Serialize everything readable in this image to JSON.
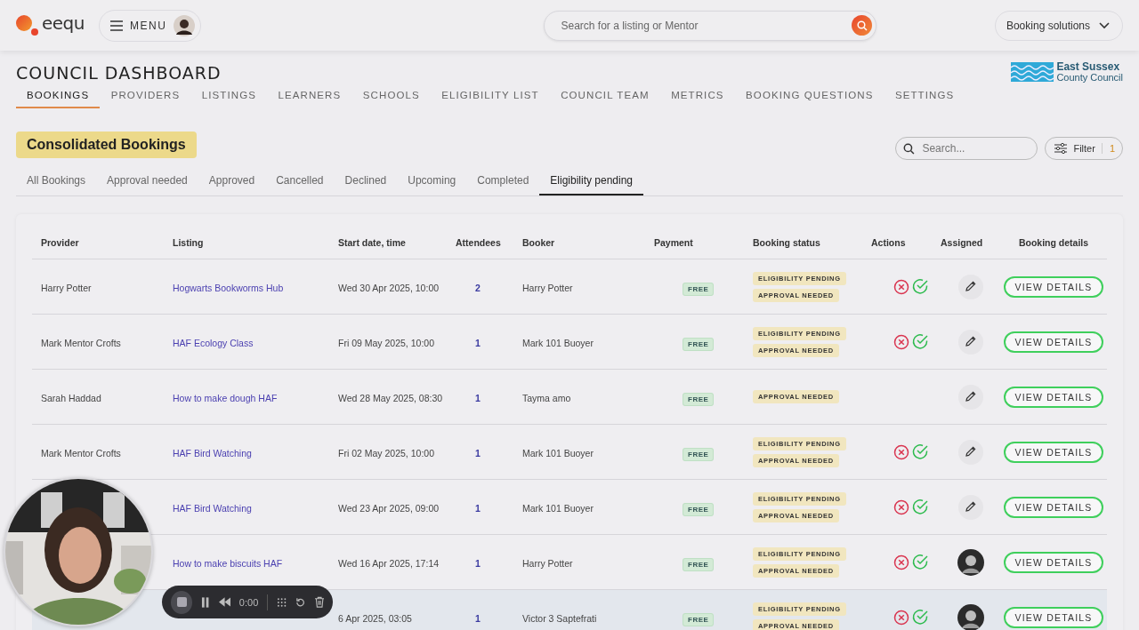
{
  "topbar": {
    "logo_text": "eequ",
    "menu_label": "MENU",
    "search": {
      "placeholder": "Search for a listing or Mentor"
    },
    "solutions": "Booking solutions"
  },
  "header": {
    "title": "COUNCIL DASHBOARD",
    "council": {
      "line1": "East Sussex",
      "line2": "County Council"
    }
  },
  "nav": [
    {
      "label": "BOOKINGS",
      "selected": true
    },
    {
      "label": "PROVIDERS",
      "selected": false
    },
    {
      "label": "LISTINGS",
      "selected": false
    },
    {
      "label": "LEARNERS",
      "selected": false
    },
    {
      "label": "SCHOOLS",
      "selected": false
    },
    {
      "label": "ELIGIBILITY LIST",
      "selected": false
    },
    {
      "label": "COUNCIL TEAM",
      "selected": false
    },
    {
      "label": "METRICS",
      "selected": false
    },
    {
      "label": "BOOKING QUESTIONS",
      "selected": false
    },
    {
      "label": "SETTINGS",
      "selected": false
    }
  ],
  "section": {
    "title": "Consolidated Bookings",
    "search": {
      "placeholder": "Search..."
    },
    "filter": {
      "label": "Filter",
      "count": "1"
    }
  },
  "tabs": [
    {
      "label": "All Bookings",
      "selected": false
    },
    {
      "label": "Approval needed",
      "selected": false
    },
    {
      "label": "Approved",
      "selected": false
    },
    {
      "label": "Cancelled",
      "selected": false
    },
    {
      "label": "Declined",
      "selected": false
    },
    {
      "label": "Upcoming",
      "selected": false
    },
    {
      "label": "Completed",
      "selected": false
    },
    {
      "label": "Eligibility pending",
      "selected": true
    }
  ],
  "table": {
    "columns": [
      "Provider",
      "Listing",
      "Start date, time",
      "Attendees",
      "Booker",
      "Payment",
      "Booking status",
      "Actions",
      "Assigned",
      "Booking details"
    ],
    "rows": [
      {
        "provider": "Harry Potter",
        "listing": "Hogwarts Bookworms Hub",
        "start": "Wed 30 Apr 2025, 10:00",
        "attendees": "2",
        "booker": "Harry Potter",
        "payment": "FREE",
        "statuses": [
          "ELIGIBILITY PENDING",
          "APPROVAL NEEDED"
        ],
        "actions": true,
        "assigned": {
          "kind": "edit"
        },
        "details": "VIEW DETAILS",
        "selected": false
      },
      {
        "provider": "Mark Mentor Crofts",
        "listing": "HAF Ecology Class",
        "start": "Fri 09 May 2025, 10:00",
        "attendees": "1",
        "booker": "Mark 101 Buoyer",
        "payment": "FREE",
        "statuses": [
          "ELIGIBILITY PENDING",
          "APPROVAL NEEDED"
        ],
        "actions": true,
        "assigned": {
          "kind": "edit"
        },
        "details": "VIEW DETAILS",
        "selected": false
      },
      {
        "provider": "Sarah Haddad",
        "listing": "How to make dough HAF",
        "start": "Wed 28 May 2025, 08:30",
        "attendees": "1",
        "booker": "Tayma amo",
        "payment": "FREE",
        "statuses": [
          "APPROVAL NEEDED"
        ],
        "actions": false,
        "assigned": {
          "kind": "edit"
        },
        "details": "VIEW DETAILS",
        "selected": false
      },
      {
        "provider": "Mark Mentor Crofts",
        "listing": "HAF Bird Watching",
        "start": "Fri 02 May 2025, 10:00",
        "attendees": "1",
        "booker": "Mark 101 Buoyer",
        "payment": "FREE",
        "statuses": [
          "ELIGIBILITY PENDING",
          "APPROVAL NEEDED"
        ],
        "actions": true,
        "assigned": {
          "kind": "edit"
        },
        "details": "VIEW DETAILS",
        "selected": false
      },
      {
        "listing": "HAF Bird Watching",
        "start": "Wed 23 Apr 2025, 09:00",
        "attendees": "1",
        "booker": "Mark 101 Buoyer",
        "payment": "FREE",
        "statuses": [
          "ELIGIBILITY PENDING",
          "APPROVAL NEEDED"
        ],
        "actions": true,
        "assigned": {
          "kind": "edit"
        },
        "details": "VIEW DETAILS",
        "selected": false
      },
      {
        "listing": "How to make biscuits HAF",
        "start": "Wed 16 Apr 2025, 17:14",
        "attendees": "1",
        "booker": "Harry Potter",
        "payment": "FREE",
        "statuses": [
          "ELIGIBILITY PENDING",
          "APPROVAL NEEDED"
        ],
        "actions": true,
        "assigned": {
          "kind": "avatar"
        },
        "details": "VIEW DETAILS",
        "selected": false
      },
      {
        "start": "6 Apr 2025, 03:05",
        "attendees": "1",
        "booker": "Victor 3 Saptefrati",
        "payment": "FREE",
        "statuses": [
          "ELIGIBILITY PENDING",
          "APPROVAL NEEDED"
        ],
        "actions": true,
        "assigned": {
          "kind": "avatar"
        },
        "details": "VIEW DETAILS",
        "selected": true
      }
    ]
  },
  "recorder": {
    "time": "0:00"
  }
}
